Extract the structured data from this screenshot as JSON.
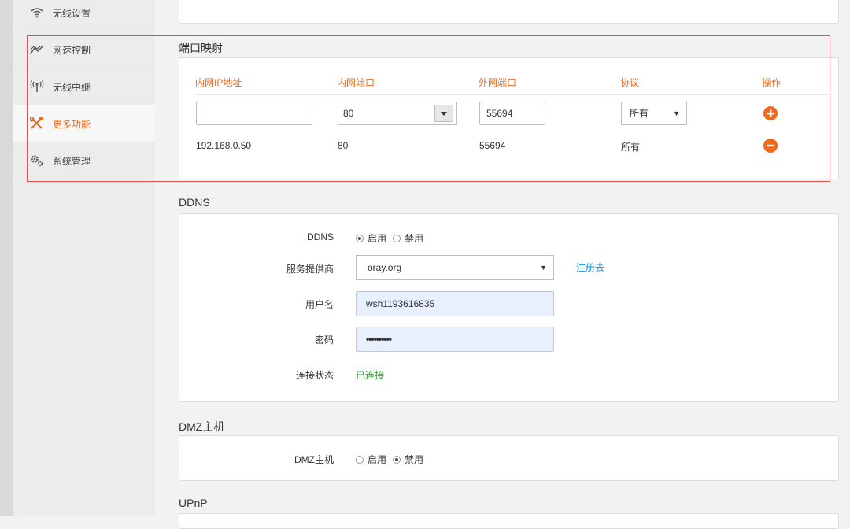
{
  "sidebar": {
    "items": [
      {
        "label": "无线设置",
        "icon": "wifi-icon"
      },
      {
        "label": "网速控制",
        "icon": "speed-chart-icon"
      },
      {
        "label": "无线中继",
        "icon": "antenna-icon"
      },
      {
        "label": "更多功能",
        "icon": "tools-icon",
        "active": true
      },
      {
        "label": "系统管理",
        "icon": "gears-icon"
      }
    ]
  },
  "port_mapping": {
    "title": "端口映射",
    "headers": [
      "内网IP地址",
      "内网端口",
      "外网端口",
      "协议",
      "操作"
    ],
    "input_row": {
      "ip": "",
      "internal_port": "80",
      "external_port": "55694",
      "protocol": "所有"
    },
    "rows": [
      {
        "ip": "192.168.0.50",
        "internal_port": "80",
        "external_port": "55694",
        "protocol": "所有"
      }
    ]
  },
  "ddns": {
    "title": "DDNS",
    "enable_label": "DDNS",
    "enable_on": "启用",
    "enable_off": "禁用",
    "enabled": true,
    "provider_label": "服务提供商",
    "provider_value": "oray.org",
    "register_link": "注册去",
    "username_label": "用户名",
    "username_value": "wsh1193616835",
    "password_label": "密码",
    "password_value": "••••••••••",
    "status_label": "连接状态",
    "status_value": "已连接"
  },
  "dmz": {
    "title": "DMZ主机",
    "label": "DMZ主机",
    "on": "启用",
    "off": "禁用",
    "enabled": false
  },
  "upnp": {
    "title": "UPnP"
  },
  "colors": {
    "accent": "#f06a1e",
    "link": "#1a8fd6",
    "success": "#2aa02a",
    "highlight_box": "#e05050"
  }
}
